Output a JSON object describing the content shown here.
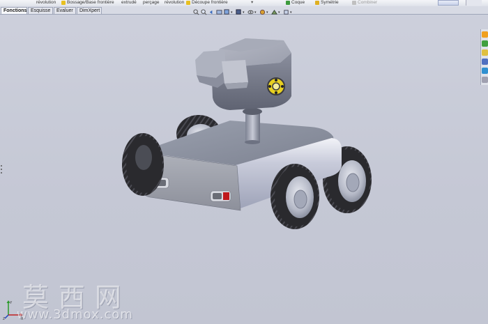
{
  "command_strip": {
    "items": [
      {
        "label": "révolution",
        "icon": "revolve-icon"
      },
      {
        "label": "Bossage/Base frontière",
        "icon": "boundary-boss-icon",
        "color": "#e8c020"
      },
      {
        "label": "extrudé",
        "icon": ""
      },
      {
        "label": "perçage",
        "icon": ""
      },
      {
        "label": "révolution",
        "icon": ""
      },
      {
        "label": "Découpe frontière",
        "icon": "boundary-cut-icon",
        "color": "#e8c020"
      },
      {
        "label": "Coque",
        "icon": "shell-icon",
        "color": "#3c9a3c"
      },
      {
        "label": "Symétrie",
        "icon": "mirror-icon",
        "color": "#e0b020"
      },
      {
        "label": "Combiner",
        "icon": "combine-icon",
        "color": "#b0b0b0"
      }
    ]
  },
  "tabs": [
    {
      "label": "Fonctions",
      "active": true
    },
    {
      "label": "Esquisse",
      "active": false
    },
    {
      "label": "Evaluer",
      "active": false
    },
    {
      "label": "DimXpert",
      "active": false
    }
  ],
  "view_toolbar": {
    "icons": [
      "zoom-to-fit-icon",
      "zoom-area-icon",
      "previous-view-icon",
      "section-view-icon",
      "view-orientation-icon",
      "display-style-icon",
      "hide-show-icon",
      "edit-appearance-icon",
      "apply-scene-icon",
      "view-settings-icon"
    ]
  },
  "task_pane": {
    "icons": [
      {
        "name": "resources-icon",
        "color": "#f0a020"
      },
      {
        "name": "design-library-icon",
        "color": "#40a040"
      },
      {
        "name": "file-explorer-icon",
        "color": "#e0c040"
      },
      {
        "name": "view-palette-icon",
        "color": "#5070c0"
      },
      {
        "name": "appearances-icon",
        "color": "#3090d0"
      },
      {
        "name": "custom-properties-icon",
        "color": "#a0a0b0"
      }
    ]
  },
  "triad": {
    "x_label": "X",
    "y_label": "Y",
    "z_label": "Z"
  },
  "watermark": {
    "chinese": "莫西网",
    "url": "www.3dmox.com"
  },
  "colors": {
    "viewport_bg": "#c9ccd8",
    "body_metal": "#aab0c4",
    "tire": "#2a2a2e",
    "rim": "#b8bcca",
    "tail_light": "#c0181c",
    "sensor_yellow": "#e8d020"
  }
}
